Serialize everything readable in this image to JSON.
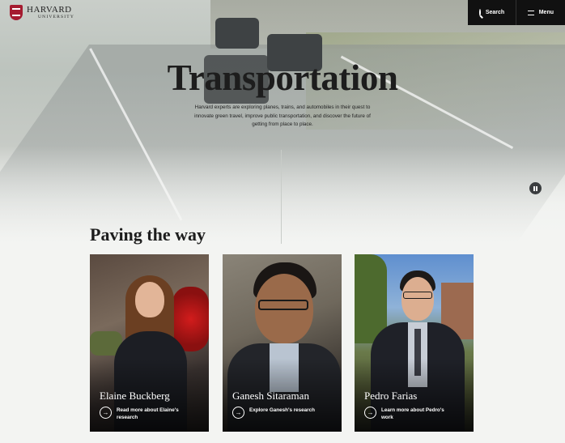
{
  "header": {
    "logo_main": "HARVARD",
    "logo_sub": "UNIVERSITY",
    "search_label": "Search",
    "menu_label": "Menu"
  },
  "hero": {
    "title": "Transportation",
    "description": "Harvard experts are exploring planes, trains, and automobiles in their quest to innovate green travel, improve public transportation, and discover the future of getting from place to place.",
    "pause_icon": "pause-icon"
  },
  "section": {
    "title": "Paving the way"
  },
  "cards": [
    {
      "name": "Elaine Buckberg",
      "cta": "Read more about Elaine's research"
    },
    {
      "name": "Ganesh Sitaraman",
      "cta": "Explore Ganesh's research"
    },
    {
      "name": "Pedro Farias",
      "cta": "Learn more about Pedro's work"
    }
  ],
  "colors": {
    "brand_crimson": "#a51c30",
    "nav_background": "#111111",
    "page_background": "#f3f4f2"
  }
}
